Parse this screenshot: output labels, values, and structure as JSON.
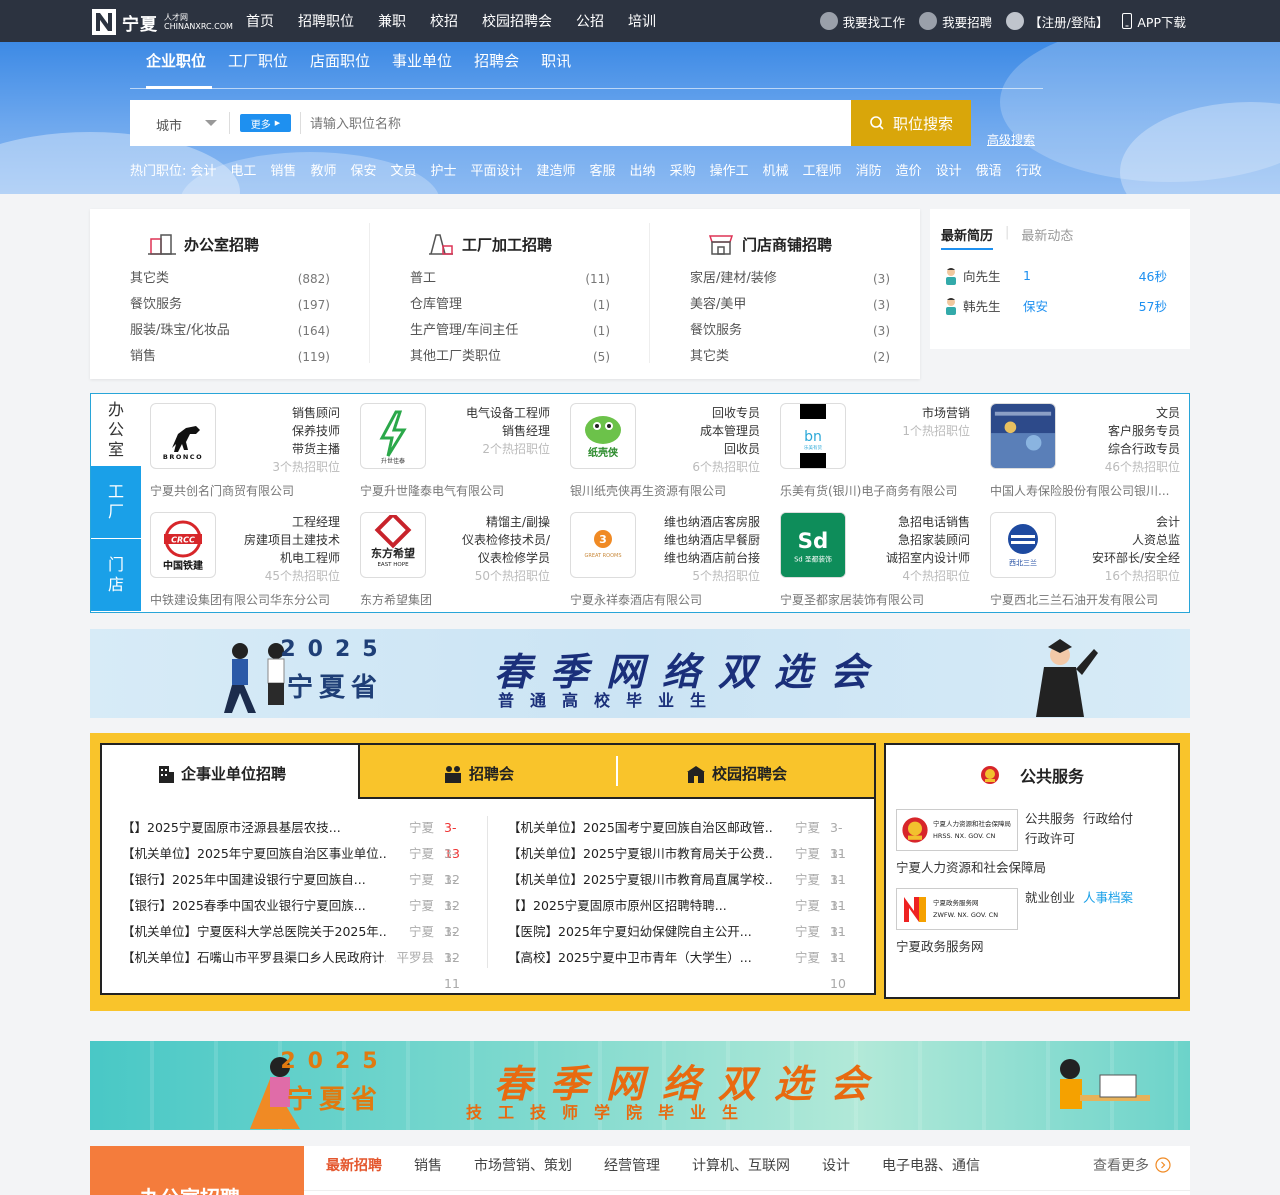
{
  "brand": {
    "name": "宁夏",
    "sub1": "人才网",
    "sub2": "CHINANXRC.COM"
  },
  "topnav": [
    "首页",
    "招聘职位",
    "兼职",
    "校招",
    "校园招聘会",
    "公招",
    "培训"
  ],
  "topright": {
    "find_job": "我要找工作",
    "recruit": "我要招聘",
    "login": "【注册/登陆】",
    "app": "APP下载"
  },
  "search": {
    "tabs": [
      "企业职位",
      "工厂职位",
      "店面职位",
      "事业单位",
      "招聘会",
      "职讯"
    ],
    "city": "城市",
    "more": "更多",
    "placeholder": "请输入职位名称",
    "button": "职位搜索",
    "advanced": "高级搜索",
    "hot_label": "热门职位:",
    "hot": [
      "会计",
      "电工",
      "销售",
      "教师",
      "保安",
      "文员",
      "护士",
      "平面设计",
      "建造师",
      "客服",
      "出纳",
      "采购",
      "操作工",
      "机械",
      "工程师",
      "消防",
      "造价",
      "设计",
      "俄语",
      "行政"
    ]
  },
  "categories": [
    {
      "title": "办公室招聘",
      "rows": [
        {
          "name": "其它类",
          "count": "(882)"
        },
        {
          "name": "餐饮服务",
          "count": "(197)"
        },
        {
          "name": "服装/珠宝/化妆品",
          "count": "(164)"
        },
        {
          "name": "销售",
          "count": "(119)"
        }
      ]
    },
    {
      "title": "工厂加工招聘",
      "rows": [
        {
          "name": "普工",
          "count": "(11)"
        },
        {
          "name": "仓库管理",
          "count": "(1)"
        },
        {
          "name": "生产管理/车间主任",
          "count": "(1)"
        },
        {
          "name": "其他工厂类职位",
          "count": "(5)"
        }
      ]
    },
    {
      "title": "门店商铺招聘",
      "rows": [
        {
          "name": "家居/建材/装修",
          "count": "(3)"
        },
        {
          "name": "美容/美甲",
          "count": "(3)"
        },
        {
          "name": "餐饮服务",
          "count": "(3)"
        },
        {
          "name": "其它类",
          "count": "(2)"
        }
      ]
    }
  ],
  "resume": {
    "tab_active": "最新简历",
    "tab_other": "最新动态",
    "rows": [
      {
        "name": "向先生",
        "job": "1",
        "time": "46秒"
      },
      {
        "name": "韩先生",
        "job": "保安",
        "time": "57秒"
      }
    ]
  },
  "ent_tabs": [
    "办\n公\n室",
    "工\n厂",
    "门\n店"
  ],
  "companies": [
    {
      "logo": "BRONCO",
      "jobs": [
        "销售顾问",
        "保养技师",
        "带货主播"
      ],
      "hot": "3个热招职位",
      "name": "宁夏共创名门商贸有限公司"
    },
    {
      "logo": "升世佳泰",
      "jobs": [
        "电气设备工程师",
        "销售经理"
      ],
      "hot": "2个热招职位",
      "name": "宁夏升世隆泰电气有限公司"
    },
    {
      "logo": "纸壳侠",
      "jobs": [
        "回收专员",
        "成本管理员",
        "回收员"
      ],
      "hot": "6个热招职位",
      "name": "银川纸壳侠再生资源有限公司"
    },
    {
      "logo": "乐美有货",
      "jobs": [
        "市场营销"
      ],
      "hot": "1个热招职位",
      "name": "乐美有货(银川)电子商务有限公司"
    },
    {
      "logo": "中国人寿",
      "jobs": [
        "文员",
        "客户服务专员",
        "综合行政专员"
      ],
      "hot": "46个热招职位",
      "name": "中国人寿保险股份有限公司银川..."
    },
    {
      "logo": "中国铁建",
      "jobs": [
        "工程经理",
        "房建项目土建技术",
        "机电工程师"
      ],
      "hot": "45个热招职位",
      "name": "中铁建设集团有限公司华东分公司"
    },
    {
      "logo": "东方希望",
      "jobs": [
        "精馏主/副操",
        "仪表检修技术员/",
        "仪表检修学员"
      ],
      "hot": "50个热招职位",
      "name": "东方希望集团"
    },
    {
      "logo": "GREAT ROOMS",
      "jobs": [
        "维也纳酒店客房服",
        "维也纳酒店早餐厨",
        "维也纳酒店前台接"
      ],
      "hot": "5个热招职位",
      "name": "宁夏永祥泰酒店有限公司"
    },
    {
      "logo": "Sd 圣都装饰",
      "jobs": [
        "急招电话销售",
        "急招家装顾问",
        "诚招室内设计师"
      ],
      "hot": "4个热招职位",
      "name": "宁夏圣都家居装饰有限公司"
    },
    {
      "logo": "西北三兰",
      "jobs": [
        "会计",
        "人资总监",
        "安环部长/安全经"
      ],
      "hot": "16个热招职位",
      "name": "宁夏西北三兰石油开发有限公司"
    }
  ],
  "banner1": {
    "year": "2025",
    "province": "宁夏省",
    "title": "春季网络双选会",
    "sub": "普通高校毕业生"
  },
  "banner2": {
    "year": "2025",
    "province": "宁夏省",
    "title": "春季网络双选会",
    "sub": "技工技师学院毕业生"
  },
  "news_tabs": [
    "企事业单位招聘",
    "招聘会",
    "校园招聘会"
  ],
  "news_left": [
    {
      "t": "【】2025宁夏固原市泾源县基层农技...",
      "loc": "宁夏",
      "d": "3-13",
      "red": true
    },
    {
      "t": "【机关单位】2025年宁夏回族自治区事业单位...",
      "loc": "宁夏",
      "d": "3-12"
    },
    {
      "t": "【银行】2025年中国建设银行宁夏回族自...",
      "loc": "宁夏",
      "d": "3-12"
    },
    {
      "t": "【银行】2025春季中国农业银行宁夏回族...",
      "loc": "宁夏",
      "d": "3-12"
    },
    {
      "t": "【机关单位】宁夏医科大学总医院关于2025年...",
      "loc": "宁夏",
      "d": "3-12"
    },
    {
      "t": "【机关单位】石嘴山市平罗县渠口乡人民政府计...",
      "loc": "平罗县",
      "d": "3-11"
    }
  ],
  "news_right": [
    {
      "t": "【机关单位】2025国考宁夏回族自治区邮政管...",
      "loc": "宁夏",
      "d": "3-11"
    },
    {
      "t": "【机关单位】2025宁夏银川市教育局关于公费...",
      "loc": "宁夏",
      "d": "3-11"
    },
    {
      "t": "【机关单位】2025宁夏银川市教育局直属学校...",
      "loc": "宁夏",
      "d": "3-11"
    },
    {
      "t": "【】2025宁夏固原市原州区招聘特聘...",
      "loc": "宁夏",
      "d": "3-11"
    },
    {
      "t": "【医院】2025年宁夏妇幼保健院自主公开...",
      "loc": "宁夏",
      "d": "3-11"
    },
    {
      "t": "【高校】2025宁夏中卫市青年（大学生）...",
      "loc": "宁夏",
      "d": "3-10"
    }
  ],
  "public": {
    "title": "公共服务",
    "items": [
      {
        "logo": "宁夏人力资源和社会保障局",
        "logo_en": "HRSS. NX. GOV. CN",
        "links": [
          "公共服务",
          "行政给付",
          "行政许可"
        ],
        "name": "宁夏人力资源和社会保障局"
      },
      {
        "logo": "宁夏政务服务网",
        "logo_en": "ZWFW. NX. GOV. CN",
        "links": [
          "就业创业",
          "人事档案"
        ],
        "name": "宁夏政务服务网"
      }
    ]
  },
  "bottom": {
    "left_title": "办公室招聘",
    "tabs": [
      "最新招聘",
      "销售",
      "市场营销、策划",
      "经营管理",
      "计算机、互联网",
      "设计",
      "电子电器、通信"
    ],
    "more": "查看更多"
  }
}
